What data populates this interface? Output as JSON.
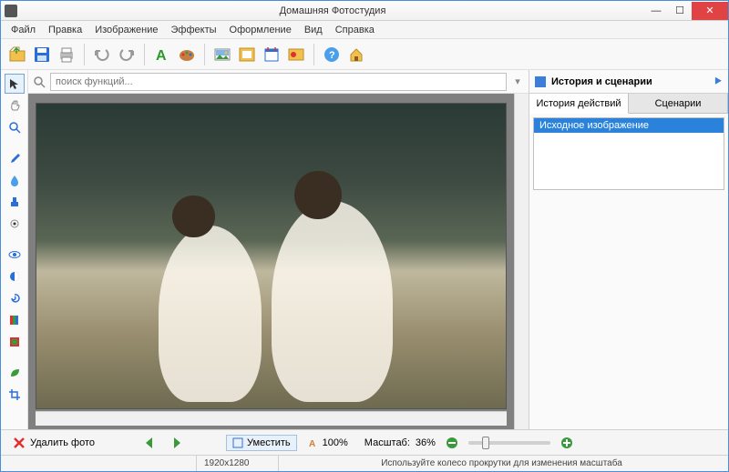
{
  "title": "Домашняя Фотостудия",
  "menu": [
    "Файл",
    "Правка",
    "Изображение",
    "Эффекты",
    "Оформление",
    "Вид",
    "Справка"
  ],
  "search": {
    "placeholder": "поиск функций..."
  },
  "rightPanel": {
    "title": "История и сценарии",
    "tabs": [
      "История действий",
      "Сценарии"
    ],
    "history": [
      "Исходное изображение"
    ]
  },
  "bottom": {
    "delete": "Удалить фото",
    "fit": "Уместить",
    "zoom100": "100%",
    "scaleLabel": "Масштаб:",
    "scaleValue": "36%"
  },
  "status": {
    "dims": "1920x1280",
    "hint": "Используйте колесо прокрутки для изменения масштаба"
  }
}
